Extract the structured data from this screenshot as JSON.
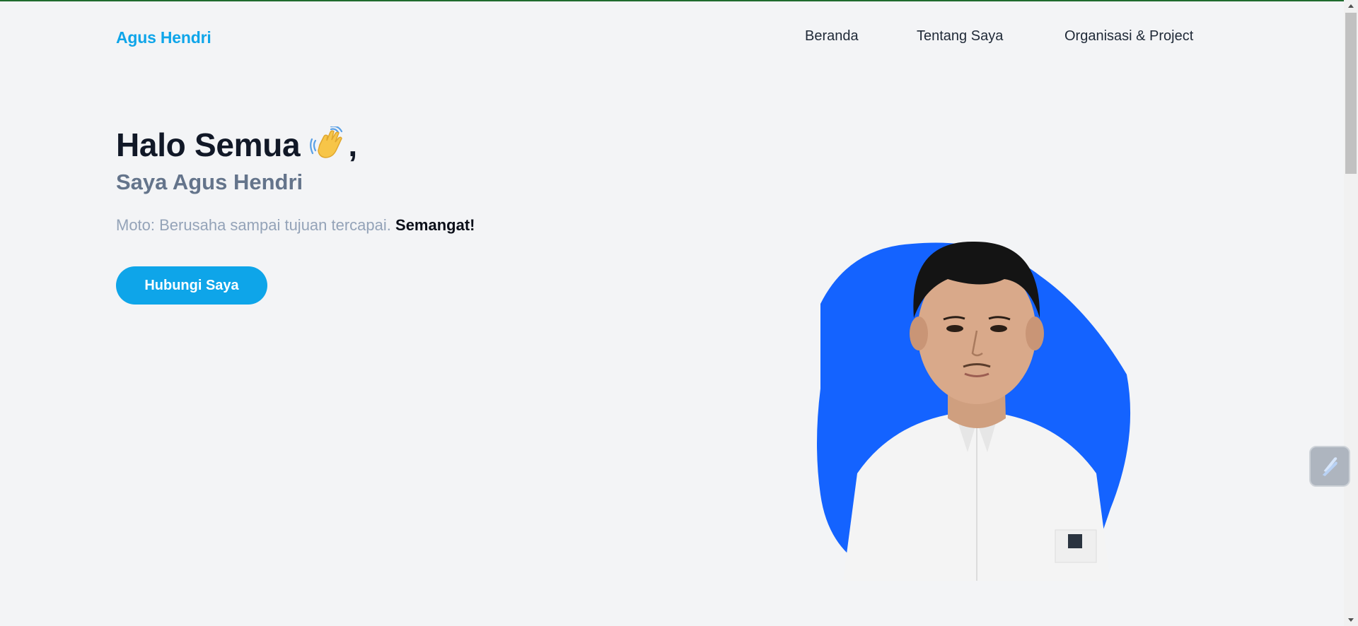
{
  "brand": "Agus Hendri",
  "nav": {
    "items": [
      "Beranda",
      "Tentang Saya",
      "Organisasi & Project"
    ]
  },
  "hero": {
    "greeting": "Halo Semua",
    "greeting_suffix": ",",
    "wave_icon": "waving-hand-icon",
    "subtitle": "Saya Agus Hendri",
    "motto_label": "Moto: Berusaha sampai tujuan tercapai.",
    "motto_highlight": "Semangat!",
    "cta_label": "Hubungi Saya"
  },
  "portrait": {
    "blob_color": "#1463ff",
    "shirt_color": "#f4f4f4"
  },
  "colors": {
    "accent": "#0ea5e9",
    "background": "#f3f4f6",
    "heading": "#111827",
    "muted": "#64748b"
  },
  "floating_widget": {
    "icon": "lightning-icon"
  }
}
